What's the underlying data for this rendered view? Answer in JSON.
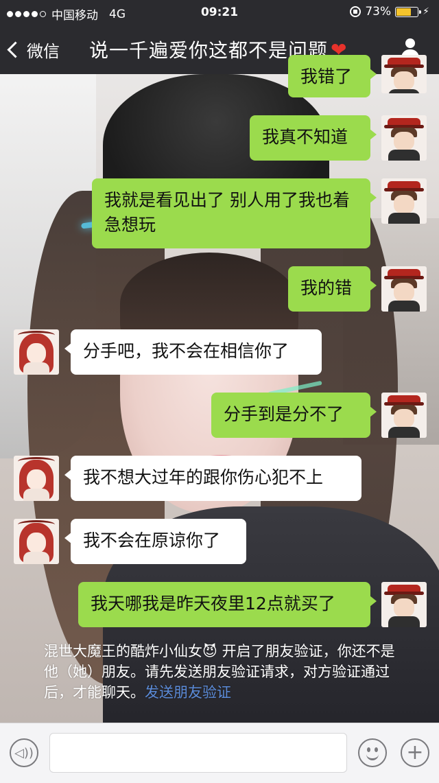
{
  "status_bar": {
    "carrier": "中国移动",
    "network": "4G",
    "time": "09:21",
    "battery": "73%",
    "battery_level": 0.73
  },
  "nav": {
    "back_label": "微信",
    "title": "说一千遍爱你这都不是问题",
    "title_emoji": "❤"
  },
  "messages": [
    {
      "from": "me",
      "text": "我错了"
    },
    {
      "from": "me",
      "text": "我真不知道"
    },
    {
      "from": "me",
      "text": "我就是看见出了 别人用了我也着急想玩"
    },
    {
      "from": "me",
      "text": "我的错"
    },
    {
      "from": "her",
      "text": "分手吧，我不会在相信你了"
    },
    {
      "from": "me",
      "text": "分手到是分不了"
    },
    {
      "from": "her",
      "text": "我不想大过年的跟你伤心犯不上"
    },
    {
      "from": "her",
      "text": "我不会在原谅你了"
    },
    {
      "from": "me",
      "text": "我天哪我是昨天夜里12点就买了"
    }
  ],
  "system_notice": {
    "text": "混世大魔王的酷炸小仙女😈 开启了朋友验证，你还不是他（她）朋友。请先发送朋友验证请求，对方验证通过后，才能聊天。",
    "link": "发送朋友验证"
  },
  "input_bar": {
    "placeholder": ""
  },
  "colors": {
    "bar_bg": "#2b2b2f",
    "my_bubble": "#9bdb4d",
    "her_bubble": "#ffffff",
    "link": "#5b8bd8",
    "battery": "#f5c42c"
  },
  "icons": [
    "signal-icon",
    "orientation-lock-icon",
    "battery-icon",
    "charging-icon",
    "back-chevron-icon",
    "person-icon",
    "voice-icon",
    "emoji-icon",
    "plus-icon"
  ]
}
